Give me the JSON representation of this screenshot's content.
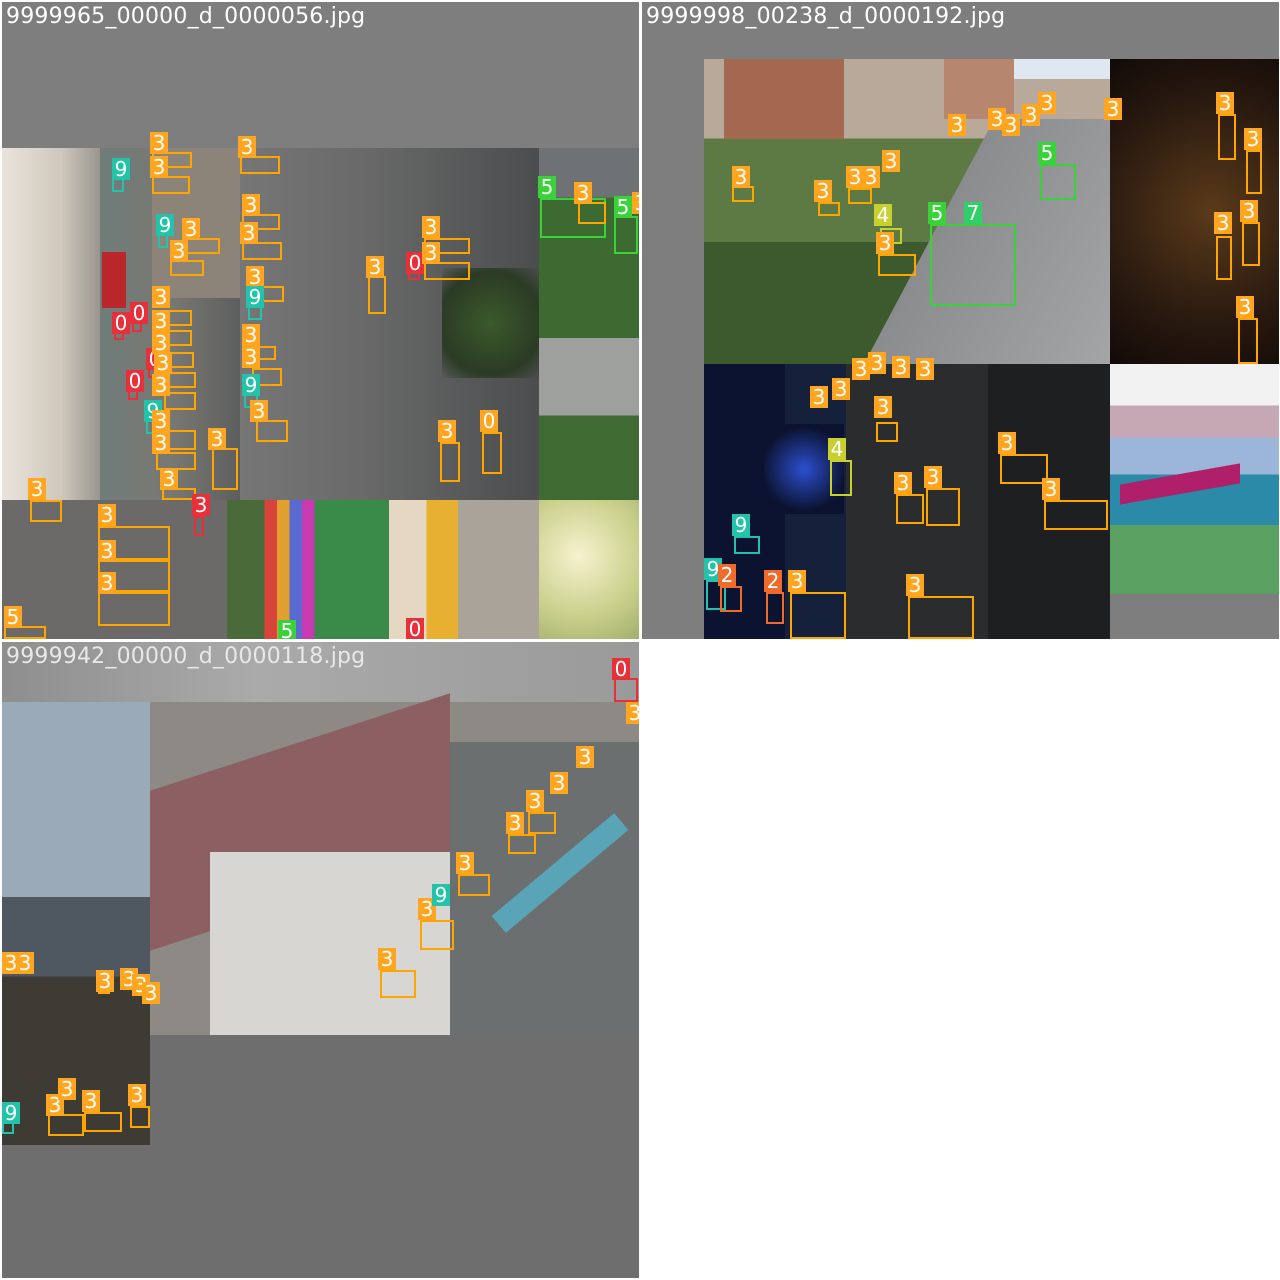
{
  "mosaic": {
    "tiles": [
      {
        "filename": "9999965_00000_d_0000056.jpg"
      },
      {
        "filename": "9999998_00238_d_0000192.jpg"
      },
      {
        "filename": "9999942_00000_d_0000118.jpg"
      }
    ]
  },
  "class_colors": {
    "0": "#E8303A",
    "2": "#F06A2A",
    "3": "#FFA51F",
    "4": "#C8D030",
    "5": "#3AD13A",
    "7": "#2FCF6A",
    "9": "#22C3A8"
  },
  "detections": {
    "tile1": [
      "9",
      "3",
      "3",
      "3",
      "3",
      "3",
      "3",
      "9",
      "3",
      "3",
      "3",
      "0",
      "3",
      "3",
      "0",
      "0",
      "3",
      "3",
      "9",
      "0",
      "3",
      "3",
      "0",
      "3",
      "9",
      "3",
      "9",
      "3",
      "3",
      "3",
      "3",
      "3",
      "3",
      "3",
      "0",
      "3",
      "3",
      "3",
      "3",
      "3",
      "5",
      "3",
      "5",
      "3",
      "5",
      "0",
      "3"
    ],
    "tile2": [
      "3",
      "3",
      "3",
      "3",
      "3",
      "3",
      "3",
      "5",
      "3",
      "3",
      "3",
      "3",
      "4",
      "5",
      "7",
      "3",
      "3",
      "3",
      "3",
      "3",
      "3",
      "3",
      "3",
      "3",
      "3",
      "3",
      "3",
      "3",
      "4",
      "3",
      "3",
      "3",
      "3",
      "9",
      "9",
      "2",
      "2",
      "3",
      "3"
    ],
    "tile3": [
      "0",
      "3",
      "3",
      "3",
      "3",
      "3",
      "3",
      "3",
      "9",
      "3",
      "3",
      "3",
      "3",
      "3",
      "3",
      "3",
      "3",
      "3",
      "3",
      "3",
      "9"
    ]
  }
}
